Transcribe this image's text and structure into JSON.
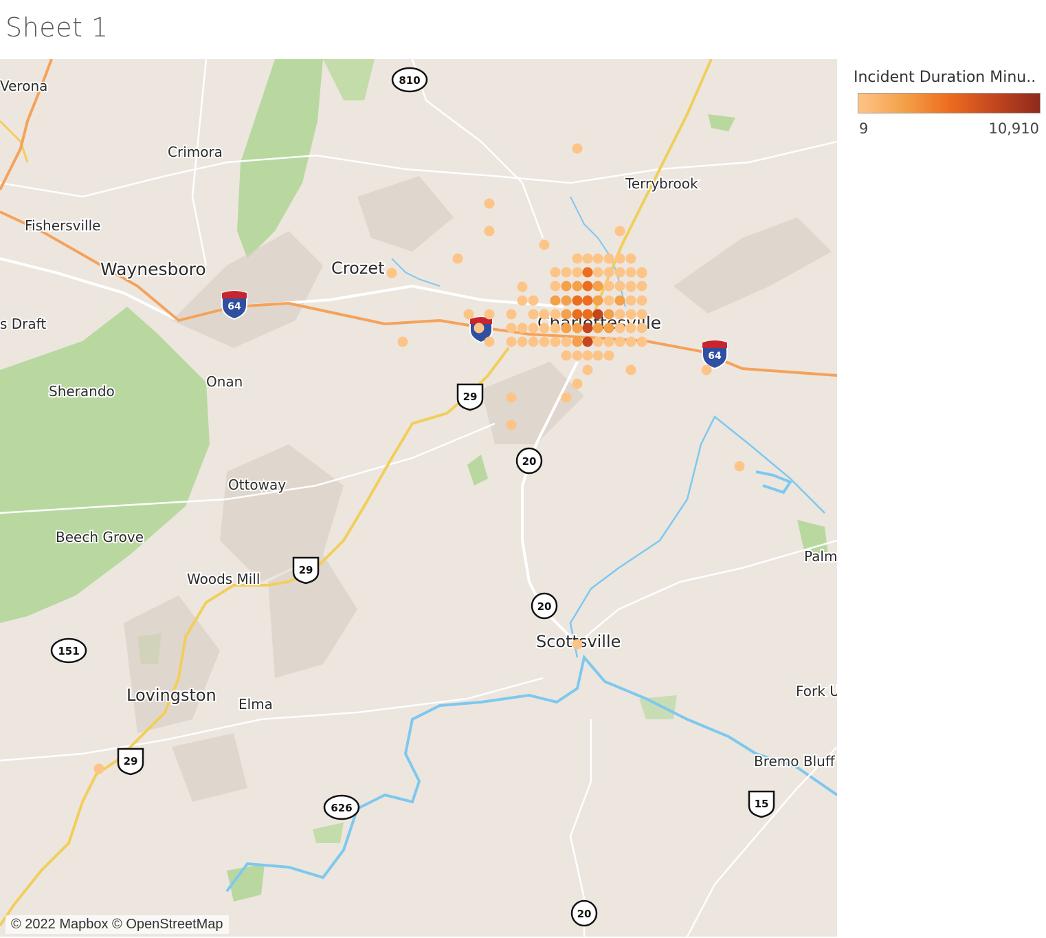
{
  "sheet": {
    "title": "Sheet 1"
  },
  "legend": {
    "title": "Incident Duration Minu..",
    "min_label": "9",
    "max_label": "10,910",
    "colors": [
      "#fdc487",
      "#f4a14a",
      "#ec6d1f",
      "#c4461f",
      "#8e2a1c"
    ]
  },
  "map": {
    "attribution": "© 2022 Mapbox © OpenStreetMap",
    "places": {
      "verona": "Verona",
      "crimora": "Crimora",
      "fishersville": "Fishersville",
      "waynesboro": "Waynesboro",
      "crozet": "Crozet",
      "terrybrook": "Terrybrook",
      "stuarts_draft": "s Draft",
      "charlottesville": "Charlottesville",
      "sherando": "Sherando",
      "onan": "Onan",
      "ottoway": "Ottoway",
      "beech_grove": "Beech Grove",
      "woods_mill": "Woods Mill",
      "palmyra": "Palm",
      "scottsville": "Scottsville",
      "lovingston": "Lovingston",
      "elma": "Elma",
      "fork_union": "Fork U",
      "bremo_bluff": "Bremo Bluff"
    },
    "shields": {
      "r810": "810",
      "i64_west": "64",
      "i64_east": "64",
      "us29_north": "29",
      "us29_middle": "29",
      "us29_south": "29",
      "r20_north": "20",
      "r20_middle": "20",
      "r20_south": "20",
      "r151": "151",
      "r626": "626",
      "us15": "15"
    }
  }
}
